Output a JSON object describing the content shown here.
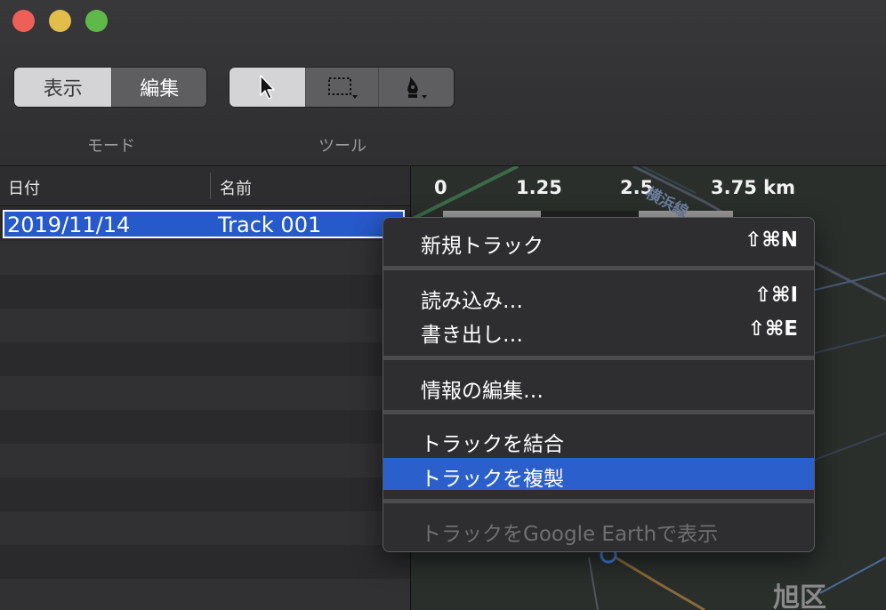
{
  "window": {
    "traffic_lights": [
      "close",
      "minimize",
      "zoom"
    ]
  },
  "toolbar": {
    "mode_segment": {
      "view_label": "表示",
      "edit_label": "編集",
      "caption": "モード",
      "selected": "表示"
    },
    "tool_segment": {
      "tools": [
        "arrow-pointer-icon",
        "rectangle-select-icon",
        "pen-icon"
      ],
      "selected": "arrow-pointer-icon",
      "caption": "ツール"
    }
  },
  "track_list": {
    "columns": [
      "日付",
      "名前"
    ],
    "rows": [
      {
        "date": "2019/11/14",
        "name": "Track 001",
        "selected": true
      }
    ]
  },
  "map": {
    "scale_labels": [
      "0",
      "1.25",
      "2.5",
      "3.75 km"
    ],
    "rail_label": "横浜線",
    "ward_label": "旭区"
  },
  "context_menu": {
    "items": [
      {
        "label": "新規トラック",
        "shortcut": "⇧⌘N"
      },
      {
        "label": "読み込み…",
        "shortcut": "⇧⌘I"
      },
      {
        "label": "書き出し…",
        "shortcut": "⇧⌘E"
      },
      {
        "label": "情報の編集…",
        "shortcut": ""
      },
      {
        "label": "トラックを結合",
        "shortcut": ""
      },
      {
        "label": "トラックを複製",
        "shortcut": "",
        "highlighted": true
      },
      {
        "label": "トラックをGoogle Earthで表示",
        "shortcut": "",
        "disabled": true
      }
    ]
  },
  "colors": {
    "selection": "#2659c9",
    "menu_highlight": "#2b5fcc",
    "close": "#ee5f57",
    "minimize": "#e2bd4a",
    "zoom": "#5fb94a"
  }
}
